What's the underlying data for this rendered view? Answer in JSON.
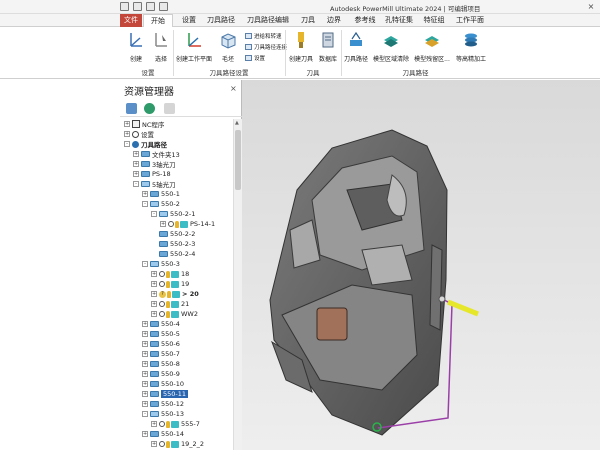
{
  "titlebar": {
    "app_title": "Autodesk PowerMill Ultimate 2024   |  可编辑项目",
    "close_label": "×"
  },
  "tabs": [
    {
      "label": "文件",
      "left": 0
    },
    {
      "label": "开始",
      "left": 0
    },
    {
      "label": "设置",
      "left": 0
    },
    {
      "label": "刀具路径",
      "left": 0
    },
    {
      "label": "刀具路径编辑",
      "left": 0
    },
    {
      "label": "刀具",
      "left": 0
    },
    {
      "label": "边界",
      "left": 0
    },
    {
      "label": "参考线",
      "left": 0
    },
    {
      "label": "孔特征集",
      "left": 0
    },
    {
      "label": "特征组",
      "left": 0
    },
    {
      "label": "工作平面",
      "left": 0
    }
  ],
  "ribbon": {
    "create_label": "创建",
    "select_label": "选择",
    "setup_group": "设置",
    "create_workplane": "创建工作平面",
    "blank_label": "毛坯",
    "feed_speed": "进给和转速",
    "toolpath_connect": "刀具路径连接",
    "set_label": "设置",
    "toolpath_settings_group": "刀具路径设置",
    "create_tool": "创建刀具",
    "tool_db": "数据库",
    "tool_group": "刀具",
    "toolpath_label": "刀具路径",
    "model_area_clear": "模型区域清除",
    "model_profile": "模型残留区...",
    "constant_z": "等高精加工",
    "toolpath_group": "刀具路径"
  },
  "explorer": {
    "title": "资源管理器",
    "close": "×",
    "tree": [
      {
        "label": "NC程序",
        "expander": "+",
        "icon": "nc"
      },
      {
        "label": "设置",
        "expander": "+",
        "icon": "set"
      },
      {
        "label": "刀具路径",
        "expander": "-",
        "icon": "tp",
        "bold": true
      },
      {
        "label": "文件夹13",
        "expander": "+",
        "icon": "folder"
      },
      {
        "label": "3轴光刀",
        "expander": "+",
        "icon": "folder"
      },
      {
        "label": "PS-18",
        "expander": "+",
        "icon": "folder"
      },
      {
        "label": "5轴光刀",
        "expander": "-",
        "icon": "folder-open"
      },
      {
        "label": "550-1",
        "expander": "+",
        "icon": "folder"
      },
      {
        "label": "550-2",
        "expander": "-",
        "icon": "folder-open"
      },
      {
        "label": "550-2-1",
        "expander": "-",
        "icon": "folder-open"
      },
      {
        "label": "PS-14-1",
        "expander": "+",
        "icon": "toolpath"
      },
      {
        "label": "550-2-2",
        "expander": "",
        "icon": "folder"
      },
      {
        "label": "550-2-3",
        "expander": "",
        "icon": "folder"
      },
      {
        "label": "550-2-4",
        "expander": "",
        "icon": "folder"
      },
      {
        "label": "550-3",
        "expander": "-",
        "icon": "folder-open"
      },
      {
        "label": "18",
        "expander": "+",
        "icon": "toolpath"
      },
      {
        "label": "19",
        "expander": "+",
        "icon": "toolpath"
      },
      {
        "label": "> 20",
        "expander": "+",
        "icon": "toolpath-q",
        "bold": true
      },
      {
        "label": "21",
        "expander": "+",
        "icon": "toolpath"
      },
      {
        "label": "WW2",
        "expander": "+",
        "icon": "toolpath"
      },
      {
        "label": "550-4",
        "expander": "+",
        "icon": "folder"
      },
      {
        "label": "550-5",
        "expander": "+",
        "icon": "folder"
      },
      {
        "label": "550-6",
        "expander": "+",
        "icon": "folder"
      },
      {
        "label": "550-7",
        "expander": "+",
        "icon": "folder"
      },
      {
        "label": "550-8",
        "expander": "+",
        "icon": "folder"
      },
      {
        "label": "550-9",
        "expander": "+",
        "icon": "folder"
      },
      {
        "label": "550-10",
        "expander": "+",
        "icon": "folder"
      },
      {
        "label": "550-11",
        "expander": "+",
        "icon": "folder",
        "selected": true
      },
      {
        "label": "550-12",
        "expander": "+",
        "icon": "folder"
      },
      {
        "label": "550-13",
        "expander": "-",
        "icon": "folder-open"
      },
      {
        "label": "555-7",
        "expander": "+",
        "icon": "toolpath"
      },
      {
        "label": "550-14",
        "expander": "+",
        "icon": "folder"
      },
      {
        "label": "19_2_2",
        "expander": "+",
        "icon": "toolpath"
      }
    ]
  },
  "colors": {
    "file_tab": "#c4473b",
    "selection": "#2a66b0",
    "toolpath": "#9b3fa8",
    "tool_yellow": "#e6e62a"
  }
}
